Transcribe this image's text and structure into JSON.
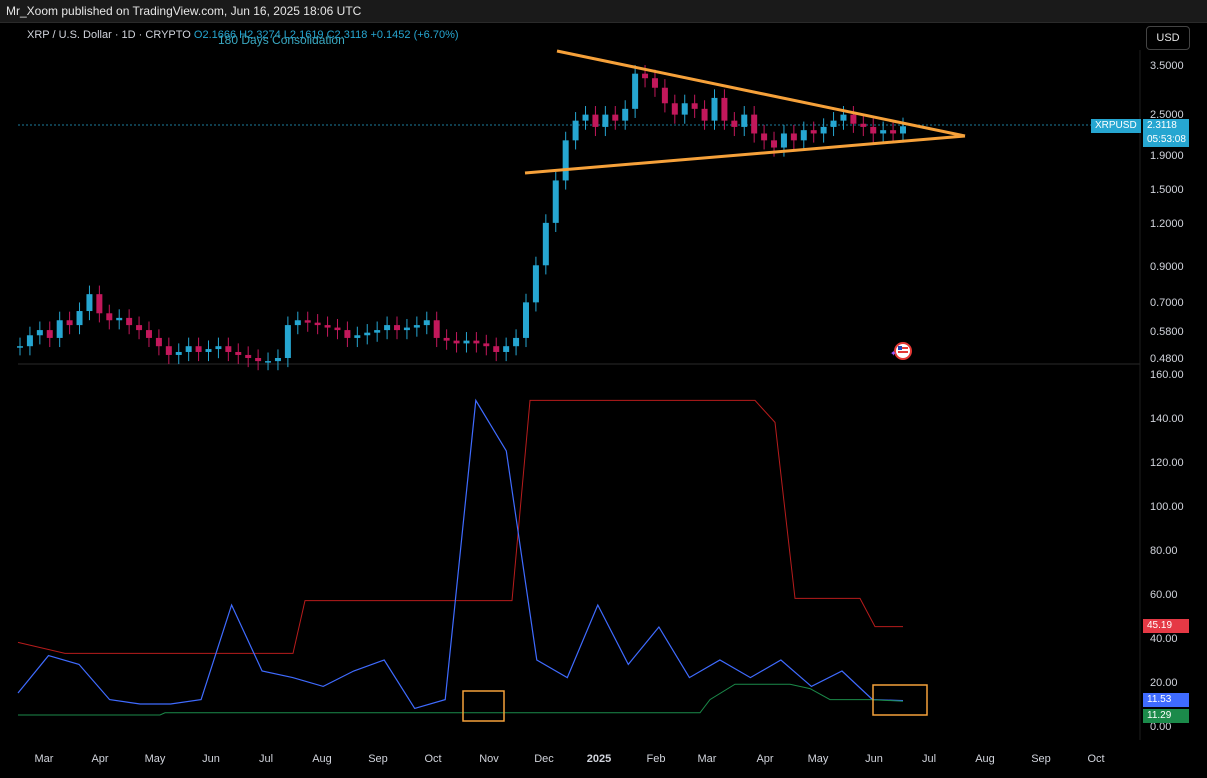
{
  "header": {
    "published": "Mr_Xoom published on TradingView.com, Jun 16, 2025 18:06 UTC"
  },
  "symbol": {
    "title": "XRP / U.S. Dollar · 1D · CRYPTO",
    "ohlc": "O2.1666 H2.3274 L2.1619 C2.3118",
    "change": "+0.1452 (+6.70%)",
    "overlay_title": "180 Days Consolidation"
  },
  "currency_button": "USD",
  "price_tag": {
    "ticker": "XRPUSD",
    "price": "2.3118",
    "countdown": "05:53:08"
  },
  "indicator_tags": {
    "red": "45.19",
    "blue": "11.53",
    "green": "11.29"
  },
  "colors": {
    "up": "#26a6d1",
    "down": "#c2185b",
    "triangle": "#f6a13a",
    "red_line": "#b71c1c",
    "blue_line": "#3f6bff",
    "green_line": "#1b8a4a"
  },
  "chart_data": [
    {
      "type": "candlestick",
      "title": "",
      "xlabel": "",
      "ylabel": "",
      "y_ticks": [
        "3.5000",
        "2.5000",
        "1.9000",
        "1.5000",
        "1.2000",
        "0.9000",
        "0.7000",
        "0.5800",
        "0.4800"
      ],
      "x_ticks": [
        "Mar",
        "Apr",
        "May",
        "Jun",
        "Jul",
        "Aug",
        "Sep",
        "Oct",
        "Nov",
        "Dec",
        "2025",
        "Feb",
        "Mar",
        "Apr",
        "May",
        "Jun",
        "Jul",
        "Aug",
        "Sep",
        "Oct"
      ],
      "series": [
        {
          "values": [
            0.52,
            0.56,
            0.58,
            0.55,
            0.62,
            0.6,
            0.66,
            0.74,
            0.65,
            0.62,
            0.63,
            0.6,
            0.58,
            0.55,
            0.52,
            0.49,
            0.5,
            0.52,
            0.5,
            0.51,
            0.52,
            0.5,
            0.49,
            0.48,
            0.47,
            0.47,
            0.48,
            0.6,
            0.62,
            0.61,
            0.6,
            0.59,
            0.58,
            0.55,
            0.56,
            0.57,
            0.58,
            0.6,
            0.58,
            0.59,
            0.6,
            0.62,
            0.55,
            0.54,
            0.53,
            0.54,
            0.53,
            0.52,
            0.5,
            0.52,
            0.55,
            0.7,
            0.9,
            1.2,
            1.6,
            2.1,
            2.4,
            2.5,
            2.3,
            2.5,
            2.4,
            2.6,
            3.3,
            3.2,
            3.0,
            2.7,
            2.5,
            2.7,
            2.6,
            2.4,
            2.8,
            2.4,
            2.3,
            2.5,
            2.2,
            2.1,
            2.0,
            2.2,
            2.1,
            2.25,
            2.2,
            2.3,
            2.4,
            2.5,
            2.35,
            2.3,
            2.2,
            2.25,
            2.2,
            2.31
          ]
        }
      ],
      "annotations": [
        "180 Days Consolidation"
      ],
      "last_value": 2.3118
    },
    {
      "type": "line",
      "title": "",
      "y_ticks": [
        "160.00",
        "140.00",
        "120.00",
        "100.00",
        "80.00",
        "60.00",
        "40.00",
        "20.00",
        "0.00"
      ],
      "ylim": [
        0,
        160
      ],
      "x": [
        "Mar",
        "Apr",
        "May",
        "Jun",
        "Jul",
        "Aug",
        "Sep",
        "Oct",
        "Nov",
        "Dec",
        "2025",
        "Feb",
        "Mar",
        "Apr",
        "May",
        "Jun"
      ],
      "series": [
        {
          "values": [
            38,
            33,
            33,
            33,
            33,
            38,
            57,
            57,
            57,
            57,
            148,
            148,
            148,
            148,
            145,
            58,
            45.19
          ]
        },
        {
          "values": [
            15,
            32,
            28,
            12,
            10,
            10,
            12,
            55,
            25,
            22,
            18,
            25,
            30,
            8,
            12,
            148,
            125,
            30,
            22,
            55,
            28,
            45,
            22,
            30,
            22,
            30,
            18,
            25,
            12,
            11.53
          ]
        },
        {
          "values": [
            5,
            5,
            5,
            5,
            5,
            5,
            5,
            6,
            6,
            6,
            6,
            6,
            6,
            6,
            6,
            6,
            7,
            7,
            7,
            7,
            19,
            19,
            18,
            12,
            11.29
          ]
        }
      ],
      "last_values": [
        45.19,
        11.53,
        11.29
      ]
    }
  ]
}
